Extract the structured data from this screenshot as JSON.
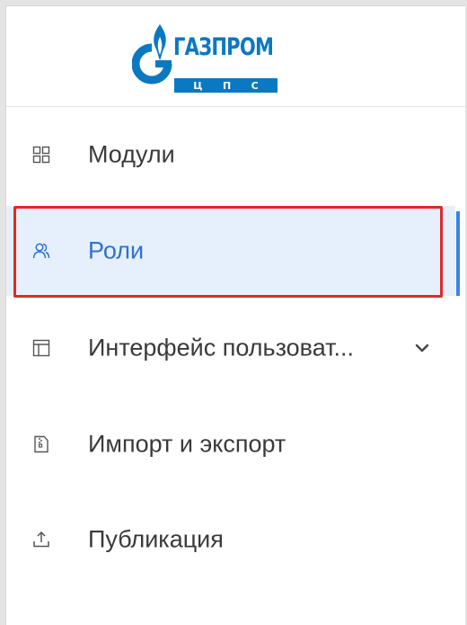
{
  "brand": {
    "logo_word": "ГАЗПРОМ",
    "logo_sub": [
      "Ц",
      "П",
      "С"
    ]
  },
  "menu": {
    "items": [
      {
        "label": "Модули",
        "icon": "grid-icon",
        "active": false
      },
      {
        "label": "Роли",
        "icon": "users-icon",
        "active": true
      },
      {
        "label": "Интерфейс пользоват...",
        "icon": "layout-icon",
        "active": false,
        "expandable": true
      },
      {
        "label": "Импорт и экспорт",
        "icon": "file-archive-icon",
        "active": false
      },
      {
        "label": "Публикация",
        "icon": "upload-icon",
        "active": false
      }
    ]
  },
  "colors": {
    "brand_blue": "#0a79c1",
    "active_bg": "#e6f0fc",
    "active_text": "#2f6fd6",
    "highlight_border": "#e02a2a"
  }
}
